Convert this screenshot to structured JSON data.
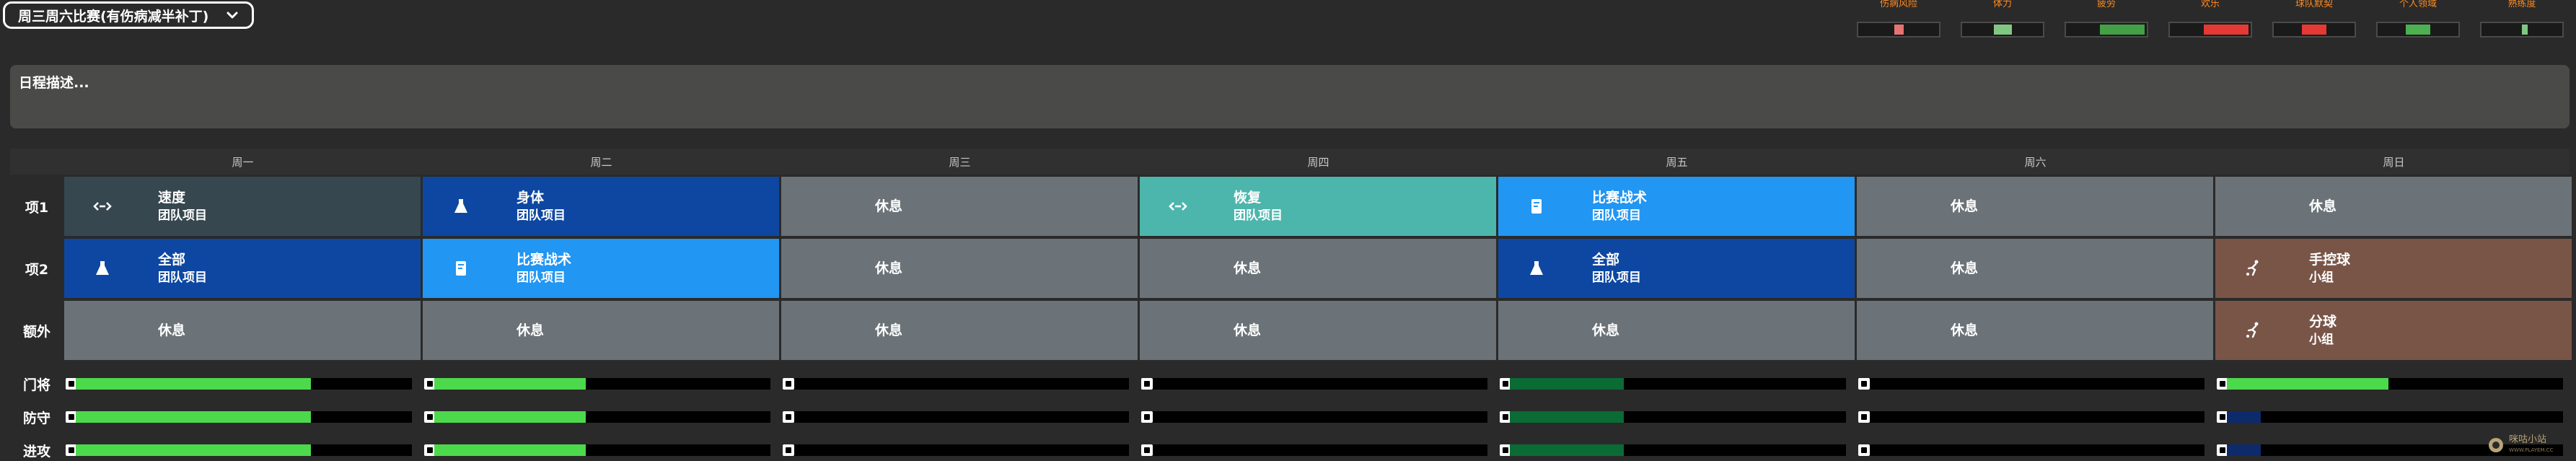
{
  "header": {
    "schedule_name": "周三周六比赛(有伤病减半补丁)"
  },
  "stats": [
    {
      "label": "伤病风险",
      "value": 0.12,
      "color": "#e57373"
    },
    {
      "label": "体力",
      "value": 0.22,
      "color": "#81c784"
    },
    {
      "label": "疲劳",
      "value": 0.55,
      "color": "#43a047"
    },
    {
      "label": "欢乐",
      "value": 0.55,
      "color": "#e53935"
    },
    {
      "label": "球队默契",
      "value": 0.3,
      "color": "#e53935"
    },
    {
      "label": "个人领域",
      "value": 0.3,
      "color": "#4caf50"
    },
    {
      "label": "熟练度",
      "value": 0.04,
      "color": "#81c784"
    }
  ],
  "description": {
    "placeholder": "日程描述..."
  },
  "days": [
    "周一",
    "周二",
    "周三",
    "周四",
    "周五",
    "周六",
    "周日"
  ],
  "rows": [
    {
      "label": "项1",
      "cells": [
        {
          "title": "速度",
          "sub": "团队项目",
          "icon": "speed-icon",
          "color": "slate"
        },
        {
          "title": "身体",
          "sub": "团队项目",
          "icon": "flask-icon",
          "color": "navy"
        },
        {
          "title": "休息",
          "sub": "",
          "icon": "",
          "color": "gray"
        },
        {
          "title": "恢复",
          "sub": "团队项目",
          "icon": "speed-icon",
          "color": "teal"
        },
        {
          "title": "比赛战术",
          "sub": "团队项目",
          "icon": "tactics-board-icon",
          "color": "blue"
        },
        {
          "title": "休息",
          "sub": "",
          "icon": "",
          "color": "gray"
        },
        {
          "title": "休息",
          "sub": "",
          "icon": "",
          "color": "gray"
        }
      ]
    },
    {
      "label": "项2",
      "cells": [
        {
          "title": "全部",
          "sub": "团队项目",
          "icon": "flask-icon",
          "color": "navy"
        },
        {
          "title": "比赛战术",
          "sub": "团队项目",
          "icon": "tactics-board-icon",
          "color": "blue"
        },
        {
          "title": "休息",
          "sub": "",
          "icon": "",
          "color": "gray"
        },
        {
          "title": "休息",
          "sub": "",
          "icon": "",
          "color": "gray"
        },
        {
          "title": "全部",
          "sub": "团队项目",
          "icon": "flask-icon",
          "color": "navy"
        },
        {
          "title": "休息",
          "sub": "",
          "icon": "",
          "color": "gray"
        },
        {
          "title": "手控球",
          "sub": "小组",
          "icon": "player-kick-icon",
          "color": "brown"
        }
      ]
    },
    {
      "label": "额外",
      "cells": [
        {
          "title": "休息",
          "sub": "",
          "icon": "",
          "color": "gray"
        },
        {
          "title": "休息",
          "sub": "",
          "icon": "",
          "color": "gray"
        },
        {
          "title": "休息",
          "sub": "",
          "icon": "",
          "color": "gray"
        },
        {
          "title": "休息",
          "sub": "",
          "icon": "",
          "color": "gray"
        },
        {
          "title": "休息",
          "sub": "",
          "icon": "",
          "color": "gray"
        },
        {
          "title": "休息",
          "sub": "",
          "icon": "",
          "color": "gray"
        },
        {
          "title": "分球",
          "sub": "小组",
          "icon": "player-kick-icon",
          "color": "brown"
        }
      ]
    }
  ],
  "progress_rows": [
    {
      "label": "门将",
      "values": [
        0.7,
        0.45,
        0,
        0,
        0.34,
        0,
        0.48
      ],
      "colors": [
        "#4cd94c",
        "#4cd94c",
        "#4cd94c",
        "#4cd94c",
        "#0b6b35",
        "#4cd94c",
        "#4cd94c"
      ]
    },
    {
      "label": "防守",
      "values": [
        0.7,
        0.45,
        0,
        0,
        0.34,
        0,
        0.1
      ],
      "colors": [
        "#4cd94c",
        "#4cd94c",
        "#4cd94c",
        "#4cd94c",
        "#0b6b35",
        "#4cd94c",
        "#0d2a6b"
      ]
    },
    {
      "label": "进攻",
      "values": [
        0.7,
        0.45,
        0,
        0,
        0.34,
        0,
        0.1
      ],
      "colors": [
        "#4cd94c",
        "#4cd94c",
        "#4cd94c",
        "#4cd94c",
        "#0b6b35",
        "#4cd94c",
        "#0d2a6b"
      ]
    }
  ],
  "watermark": {
    "name": "咪咕小站",
    "url": "WWW.PLAYEM.CC"
  }
}
